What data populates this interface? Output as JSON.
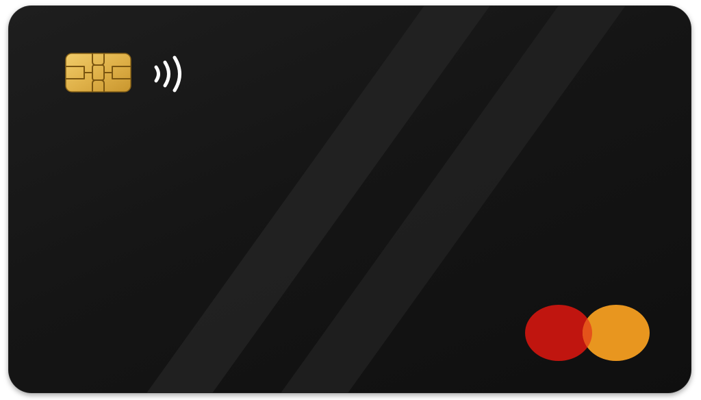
{
  "card": {
    "type": "payment-card",
    "finish": "matte-black",
    "features": [
      "emv-chip",
      "contactless",
      "card-network-logo"
    ]
  },
  "icons": {
    "chip": "emv-chip-icon",
    "contactless": "contactless-icon",
    "network": "card-network-logo"
  },
  "colors": {
    "card_background": "#141414",
    "stripe": "#242424",
    "chip_gold": "#e0b24a",
    "contactless": "#ffffff",
    "logo_red": "#c0150f",
    "logo_orange": "#e8961f",
    "logo_overlap": "#e4521a"
  }
}
